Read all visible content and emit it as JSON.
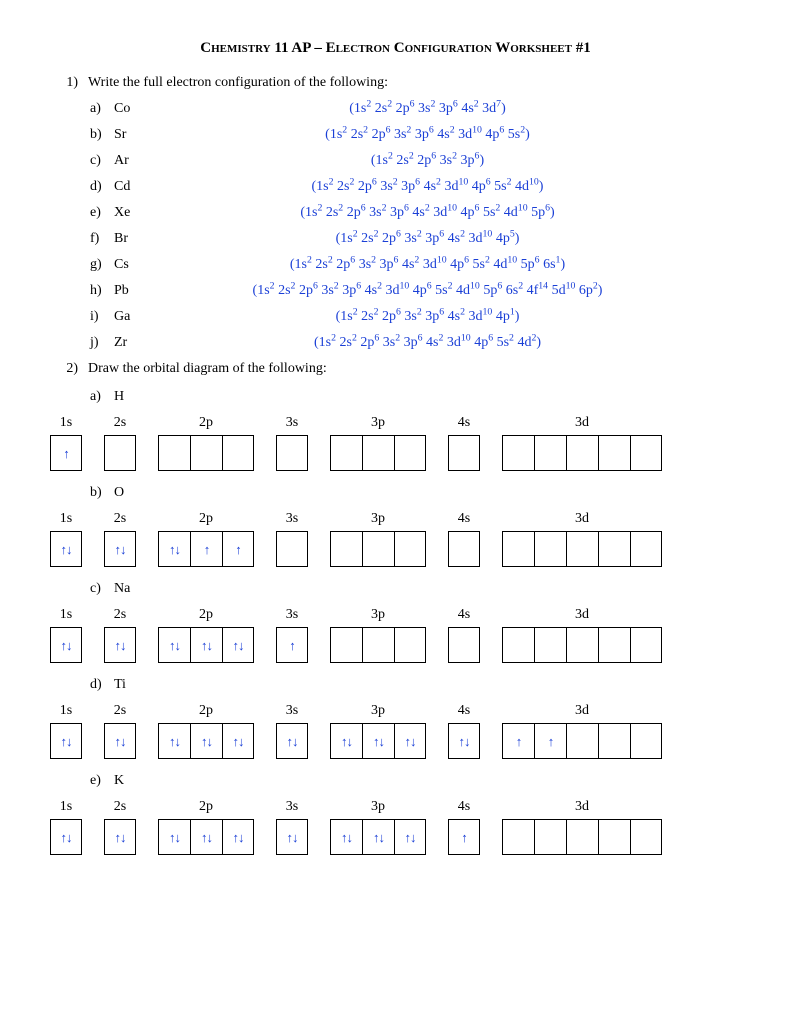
{
  "title": "Chemistry 11 AP – Electron Configuration Worksheet #1",
  "q1": {
    "num": "1)",
    "text": "Write the full electron configuration of the following:",
    "items": [
      {
        "l": "a)",
        "sym": "Co",
        "ans": [
          [
            "1s",
            "2"
          ],
          [
            "2s",
            "2"
          ],
          [
            "2p",
            "6"
          ],
          [
            "3s",
            "2"
          ],
          [
            "3p",
            "6"
          ],
          [
            "4s",
            "2"
          ],
          [
            "3d",
            "7"
          ]
        ]
      },
      {
        "l": "b)",
        "sym": "Sr",
        "ans": [
          [
            "1s",
            "2"
          ],
          [
            "2s",
            "2"
          ],
          [
            "2p",
            "6"
          ],
          [
            "3s",
            "2"
          ],
          [
            "3p",
            "6"
          ],
          [
            "4s",
            "2"
          ],
          [
            "3d",
            "10"
          ],
          [
            "4p",
            "6"
          ],
          [
            "5s",
            "2"
          ]
        ]
      },
      {
        "l": "c)",
        "sym": "Ar",
        "ans": [
          [
            "1s",
            "2"
          ],
          [
            "2s",
            "2"
          ],
          [
            "2p",
            "6"
          ],
          [
            "3s",
            "2"
          ],
          [
            "3p",
            "6"
          ]
        ]
      },
      {
        "l": "d)",
        "sym": "Cd",
        "ans": [
          [
            "1s",
            "2"
          ],
          [
            "2s",
            "2"
          ],
          [
            "2p",
            "6"
          ],
          [
            "3s",
            "2"
          ],
          [
            "3p",
            "6"
          ],
          [
            "4s",
            "2"
          ],
          [
            "3d",
            "10"
          ],
          [
            "4p",
            "6"
          ],
          [
            "5s",
            "2"
          ],
          [
            "4d",
            "10"
          ]
        ]
      },
      {
        "l": "e)",
        "sym": "Xe",
        "ans": [
          [
            "1s",
            "2"
          ],
          [
            "2s",
            "2"
          ],
          [
            "2p",
            "6"
          ],
          [
            "3s",
            "2"
          ],
          [
            "3p",
            "6"
          ],
          [
            "4s",
            "2"
          ],
          [
            "3d",
            "10"
          ],
          [
            "4p",
            "6"
          ],
          [
            "5s",
            "2"
          ],
          [
            "4d",
            "10"
          ],
          [
            "5p",
            "6"
          ]
        ]
      },
      {
        "l": "f)",
        "sym": "Br",
        "ans": [
          [
            "1s",
            "2"
          ],
          [
            "2s",
            "2"
          ],
          [
            "2p",
            "6"
          ],
          [
            "3s",
            "2"
          ],
          [
            "3p",
            "6"
          ],
          [
            "4s",
            "2"
          ],
          [
            "3d",
            "10"
          ],
          [
            "4p",
            "5"
          ]
        ]
      },
      {
        "l": "g)",
        "sym": "Cs",
        "ans": [
          [
            "1s",
            "2"
          ],
          [
            "2s",
            "2"
          ],
          [
            "2p",
            "6"
          ],
          [
            "3s",
            "2"
          ],
          [
            "3p",
            "6"
          ],
          [
            "4s",
            "2"
          ],
          [
            "3d",
            "10"
          ],
          [
            "4p",
            "6"
          ],
          [
            "5s",
            "2"
          ],
          [
            "4d",
            "10"
          ],
          [
            "5p",
            "6"
          ],
          [
            "6s",
            "1"
          ]
        ]
      },
      {
        "l": "h)",
        "sym": "Pb",
        "ans": [
          [
            "1s",
            "2"
          ],
          [
            "2s",
            "2"
          ],
          [
            "2p",
            "6"
          ],
          [
            "3s",
            "2"
          ],
          [
            "3p",
            "6"
          ],
          [
            "4s",
            "2"
          ],
          [
            "3d",
            "10"
          ],
          [
            "4p",
            "6"
          ],
          [
            "5s",
            "2"
          ],
          [
            "4d",
            "10"
          ],
          [
            "5p",
            "6"
          ],
          [
            "6s",
            "2"
          ],
          [
            "4f",
            "14"
          ],
          [
            "5d",
            "10"
          ],
          [
            "6p",
            "2"
          ]
        ]
      },
      {
        "l": "i)",
        "sym": "Ga",
        "ans": [
          [
            "1s",
            "2"
          ],
          [
            "2s",
            "2"
          ],
          [
            "2p",
            "6"
          ],
          [
            "3s",
            "2"
          ],
          [
            "3p",
            "6"
          ],
          [
            "4s",
            "2"
          ],
          [
            "3d",
            "10"
          ],
          [
            "4p",
            "1"
          ]
        ]
      },
      {
        "l": "j)",
        "sym": "Zr",
        "ans": [
          [
            "1s",
            "2"
          ],
          [
            "2s",
            "2"
          ],
          [
            "2p",
            "6"
          ],
          [
            "3s",
            "2"
          ],
          [
            "3p",
            "6"
          ],
          [
            "4s",
            "2"
          ],
          [
            "3d",
            "10"
          ],
          [
            "4p",
            "6"
          ],
          [
            "5s",
            "2"
          ],
          [
            "4d",
            "2"
          ]
        ]
      }
    ]
  },
  "q2": {
    "num": "2)",
    "text": "Draw the orbital diagram of the following:",
    "orbitals": [
      "1s",
      "2s",
      "2p",
      "3s",
      "3p",
      "4s",
      "3d"
    ],
    "counts": [
      1,
      1,
      3,
      1,
      3,
      1,
      5
    ],
    "items": [
      {
        "l": "a)",
        "sym": "H",
        "boxes": [
          [
            "u"
          ],
          [
            ""
          ],
          [
            "",
            "",
            ""
          ],
          [
            ""
          ],
          [
            "",
            "",
            ""
          ],
          [
            ""
          ],
          [
            "",
            "",
            "",
            "",
            ""
          ]
        ]
      },
      {
        "l": "b)",
        "sym": "O",
        "boxes": [
          [
            "ud"
          ],
          [
            "ud"
          ],
          [
            "ud",
            "u",
            "u"
          ],
          [
            ""
          ],
          [
            "",
            "",
            ""
          ],
          [
            ""
          ],
          [
            "",
            "",
            "",
            "",
            ""
          ]
        ]
      },
      {
        "l": "c)",
        "sym": "Na",
        "boxes": [
          [
            "ud"
          ],
          [
            "ud"
          ],
          [
            "ud",
            "ud",
            "ud"
          ],
          [
            "u"
          ],
          [
            "",
            "",
            ""
          ],
          [
            ""
          ],
          [
            "",
            "",
            "",
            "",
            ""
          ]
        ]
      },
      {
        "l": "d)",
        "sym": "Ti",
        "boxes": [
          [
            "ud"
          ],
          [
            "ud"
          ],
          [
            "ud",
            "ud",
            "ud"
          ],
          [
            "ud"
          ],
          [
            "ud",
            "ud",
            "ud"
          ],
          [
            "ud"
          ],
          [
            "u",
            "u",
            "",
            "",
            ""
          ]
        ]
      },
      {
        "l": "e)",
        "sym": "K",
        "boxes": [
          [
            "ud"
          ],
          [
            "ud"
          ],
          [
            "ud",
            "ud",
            "ud"
          ],
          [
            "ud"
          ],
          [
            "ud",
            "ud",
            "ud"
          ],
          [
            "u"
          ],
          [
            "",
            "",
            "",
            "",
            ""
          ]
        ]
      }
    ]
  },
  "glyphs": {
    "u": "↑",
    "d": "↓",
    "ud": "↑↓"
  }
}
